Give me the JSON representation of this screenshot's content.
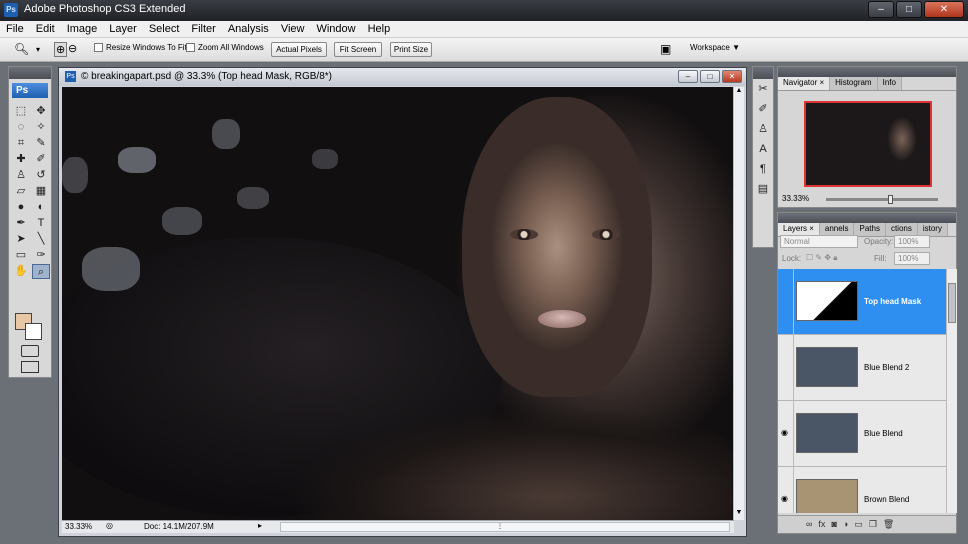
{
  "app": {
    "title": "Adobe Photoshop CS3 Extended",
    "badge": "Ps"
  },
  "window_controls": {
    "minimize": "–",
    "maximize": "□",
    "close": "✕"
  },
  "menu": [
    "File",
    "Edit",
    "Image",
    "Layer",
    "Select",
    "Filter",
    "Analysis",
    "View",
    "Window",
    "Help"
  ],
  "options": {
    "resize_windows": "Resize Windows To Fit",
    "zoom_all": "Zoom All Windows",
    "actual_pixels": "Actual Pixels",
    "fit_screen": "Fit Screen",
    "print_size": "Print Size",
    "workspace": "Workspace ▼"
  },
  "tools_panel": {
    "logo": "Ps",
    "foreground_color": "#e9c6a6",
    "background_color": "#ffffff"
  },
  "document": {
    "title": "© breakingapart.psd @ 33.3% (Top head Mask, RGB/8*)",
    "zoom": "33.33%",
    "doc_size": "Doc: 14.1M/207.9M"
  },
  "navigator": {
    "tabs": [
      "Navigator ×",
      "Histogram",
      "Info"
    ],
    "zoom": "33.33%"
  },
  "layers_panel": {
    "tabs": [
      "Layers ×",
      "annels",
      "Paths",
      "ctions",
      "istory"
    ],
    "blend_mode": "Normal",
    "opacity_label": "Opacity:",
    "opacity": "100%",
    "lock_label": "Lock:",
    "fill_label": "Fill:",
    "fill": "100%",
    "layers": [
      {
        "name": "Top head Mask",
        "selected": true,
        "visible": false
      },
      {
        "name": "Blue Blend 2",
        "selected": false,
        "visible": false
      },
      {
        "name": "Blue Blend",
        "selected": false,
        "visible": true
      },
      {
        "name": "Brown Blend",
        "selected": false,
        "visible": true
      }
    ],
    "footer_icons": [
      "link-icon",
      "fx-icon",
      "mask-icon",
      "adjustment-icon",
      "folder-icon",
      "new-layer-icon",
      "trash-icon"
    ]
  }
}
